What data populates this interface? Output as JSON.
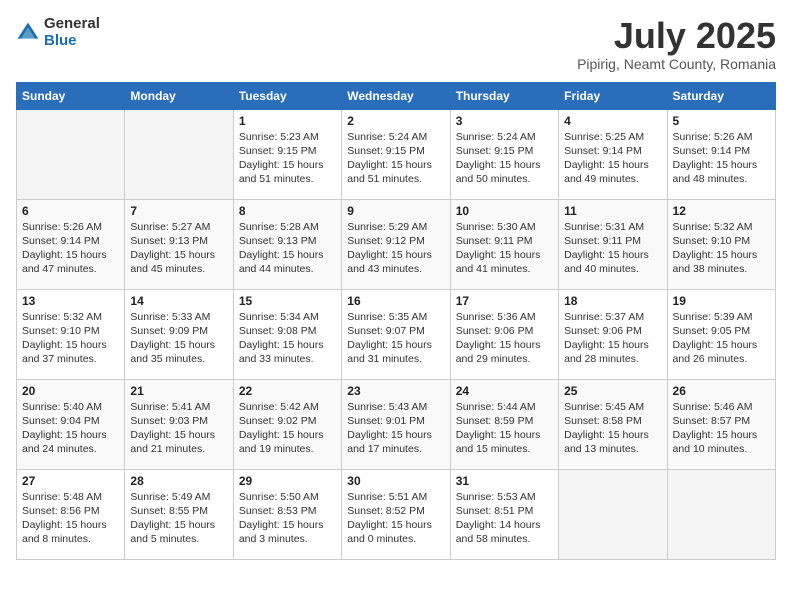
{
  "header": {
    "logo_general": "General",
    "logo_blue": "Blue",
    "month_year": "July 2025",
    "location": "Pipirig, Neamt County, Romania"
  },
  "weekdays": [
    "Sunday",
    "Monday",
    "Tuesday",
    "Wednesday",
    "Thursday",
    "Friday",
    "Saturday"
  ],
  "weeks": [
    [
      {
        "day": "",
        "detail": ""
      },
      {
        "day": "",
        "detail": ""
      },
      {
        "day": "1",
        "detail": "Sunrise: 5:23 AM\nSunset: 9:15 PM\nDaylight: 15 hours\nand 51 minutes."
      },
      {
        "day": "2",
        "detail": "Sunrise: 5:24 AM\nSunset: 9:15 PM\nDaylight: 15 hours\nand 51 minutes."
      },
      {
        "day": "3",
        "detail": "Sunrise: 5:24 AM\nSunset: 9:15 PM\nDaylight: 15 hours\nand 50 minutes."
      },
      {
        "day": "4",
        "detail": "Sunrise: 5:25 AM\nSunset: 9:14 PM\nDaylight: 15 hours\nand 49 minutes."
      },
      {
        "day": "5",
        "detail": "Sunrise: 5:26 AM\nSunset: 9:14 PM\nDaylight: 15 hours\nand 48 minutes."
      }
    ],
    [
      {
        "day": "6",
        "detail": "Sunrise: 5:26 AM\nSunset: 9:14 PM\nDaylight: 15 hours\nand 47 minutes."
      },
      {
        "day": "7",
        "detail": "Sunrise: 5:27 AM\nSunset: 9:13 PM\nDaylight: 15 hours\nand 45 minutes."
      },
      {
        "day": "8",
        "detail": "Sunrise: 5:28 AM\nSunset: 9:13 PM\nDaylight: 15 hours\nand 44 minutes."
      },
      {
        "day": "9",
        "detail": "Sunrise: 5:29 AM\nSunset: 9:12 PM\nDaylight: 15 hours\nand 43 minutes."
      },
      {
        "day": "10",
        "detail": "Sunrise: 5:30 AM\nSunset: 9:11 PM\nDaylight: 15 hours\nand 41 minutes."
      },
      {
        "day": "11",
        "detail": "Sunrise: 5:31 AM\nSunset: 9:11 PM\nDaylight: 15 hours\nand 40 minutes."
      },
      {
        "day": "12",
        "detail": "Sunrise: 5:32 AM\nSunset: 9:10 PM\nDaylight: 15 hours\nand 38 minutes."
      }
    ],
    [
      {
        "day": "13",
        "detail": "Sunrise: 5:32 AM\nSunset: 9:10 PM\nDaylight: 15 hours\nand 37 minutes."
      },
      {
        "day": "14",
        "detail": "Sunrise: 5:33 AM\nSunset: 9:09 PM\nDaylight: 15 hours\nand 35 minutes."
      },
      {
        "day": "15",
        "detail": "Sunrise: 5:34 AM\nSunset: 9:08 PM\nDaylight: 15 hours\nand 33 minutes."
      },
      {
        "day": "16",
        "detail": "Sunrise: 5:35 AM\nSunset: 9:07 PM\nDaylight: 15 hours\nand 31 minutes."
      },
      {
        "day": "17",
        "detail": "Sunrise: 5:36 AM\nSunset: 9:06 PM\nDaylight: 15 hours\nand 29 minutes."
      },
      {
        "day": "18",
        "detail": "Sunrise: 5:37 AM\nSunset: 9:06 PM\nDaylight: 15 hours\nand 28 minutes."
      },
      {
        "day": "19",
        "detail": "Sunrise: 5:39 AM\nSunset: 9:05 PM\nDaylight: 15 hours\nand 26 minutes."
      }
    ],
    [
      {
        "day": "20",
        "detail": "Sunrise: 5:40 AM\nSunset: 9:04 PM\nDaylight: 15 hours\nand 24 minutes."
      },
      {
        "day": "21",
        "detail": "Sunrise: 5:41 AM\nSunset: 9:03 PM\nDaylight: 15 hours\nand 21 minutes."
      },
      {
        "day": "22",
        "detail": "Sunrise: 5:42 AM\nSunset: 9:02 PM\nDaylight: 15 hours\nand 19 minutes."
      },
      {
        "day": "23",
        "detail": "Sunrise: 5:43 AM\nSunset: 9:01 PM\nDaylight: 15 hours\nand 17 minutes."
      },
      {
        "day": "24",
        "detail": "Sunrise: 5:44 AM\nSunset: 8:59 PM\nDaylight: 15 hours\nand 15 minutes."
      },
      {
        "day": "25",
        "detail": "Sunrise: 5:45 AM\nSunset: 8:58 PM\nDaylight: 15 hours\nand 13 minutes."
      },
      {
        "day": "26",
        "detail": "Sunrise: 5:46 AM\nSunset: 8:57 PM\nDaylight: 15 hours\nand 10 minutes."
      }
    ],
    [
      {
        "day": "27",
        "detail": "Sunrise: 5:48 AM\nSunset: 8:56 PM\nDaylight: 15 hours\nand 8 minutes."
      },
      {
        "day": "28",
        "detail": "Sunrise: 5:49 AM\nSunset: 8:55 PM\nDaylight: 15 hours\nand 5 minutes."
      },
      {
        "day": "29",
        "detail": "Sunrise: 5:50 AM\nSunset: 8:53 PM\nDaylight: 15 hours\nand 3 minutes."
      },
      {
        "day": "30",
        "detail": "Sunrise: 5:51 AM\nSunset: 8:52 PM\nDaylight: 15 hours\nand 0 minutes."
      },
      {
        "day": "31",
        "detail": "Sunrise: 5:53 AM\nSunset: 8:51 PM\nDaylight: 14 hours\nand 58 minutes."
      },
      {
        "day": "",
        "detail": ""
      },
      {
        "day": "",
        "detail": ""
      }
    ]
  ]
}
